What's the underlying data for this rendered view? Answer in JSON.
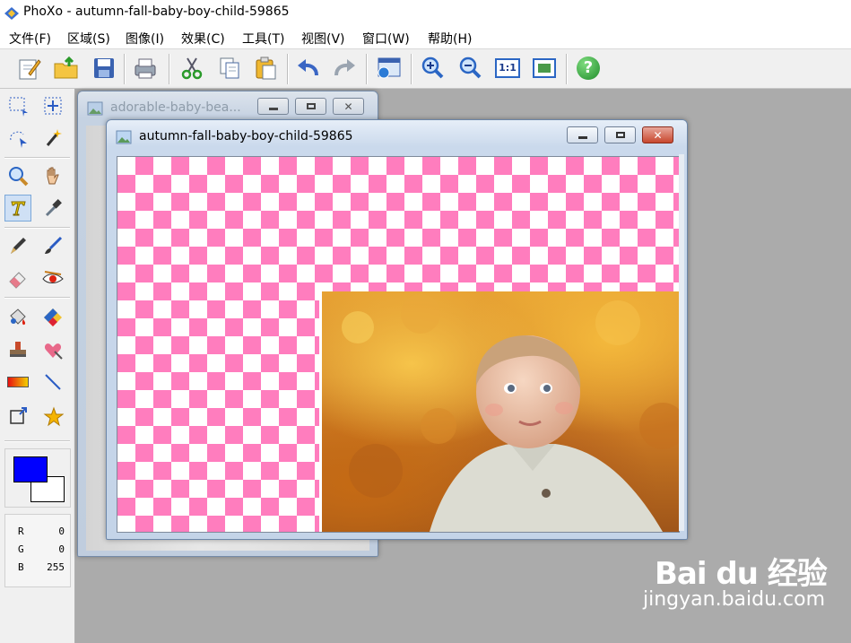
{
  "app": {
    "title": "PhoXo - autumn-fall-baby-boy-child-59865"
  },
  "menu": [
    {
      "label": "文件(F)"
    },
    {
      "label": "区域(S)"
    },
    {
      "label": "图像(I)"
    },
    {
      "label": "效果(C)"
    },
    {
      "label": "工具(T)"
    },
    {
      "label": "视图(V)"
    },
    {
      "label": "窗口(W)"
    },
    {
      "label": "帮助(H)"
    }
  ],
  "toolbar": {
    "actual_size_label": "1:1",
    "help_label": "?"
  },
  "tools": [
    "rect-select",
    "move-selection",
    "lasso-select",
    "magic-wand",
    "zoom",
    "hand",
    "text",
    "eyedropper",
    "pen",
    "brush",
    "eraser",
    "red-eye",
    "fill",
    "color-replace",
    "clone-stamp",
    "heart-shape",
    "gradient",
    "line",
    "crop-transform",
    "star-shape"
  ],
  "colors": {
    "foreground": "#0000ff",
    "background": "#ffffff"
  },
  "rgb": [
    {
      "key": "R",
      "value": "0"
    },
    {
      "key": "G",
      "value": "0"
    },
    {
      "key": "B",
      "value": "255"
    }
  ],
  "windows": {
    "background": {
      "title": "adorable-baby-bea..."
    },
    "main": {
      "title": "autumn-fall-baby-boy-child-59865"
    }
  },
  "watermark": {
    "logo": "Bai du 经验",
    "url": "jingyan.baidu.com"
  }
}
